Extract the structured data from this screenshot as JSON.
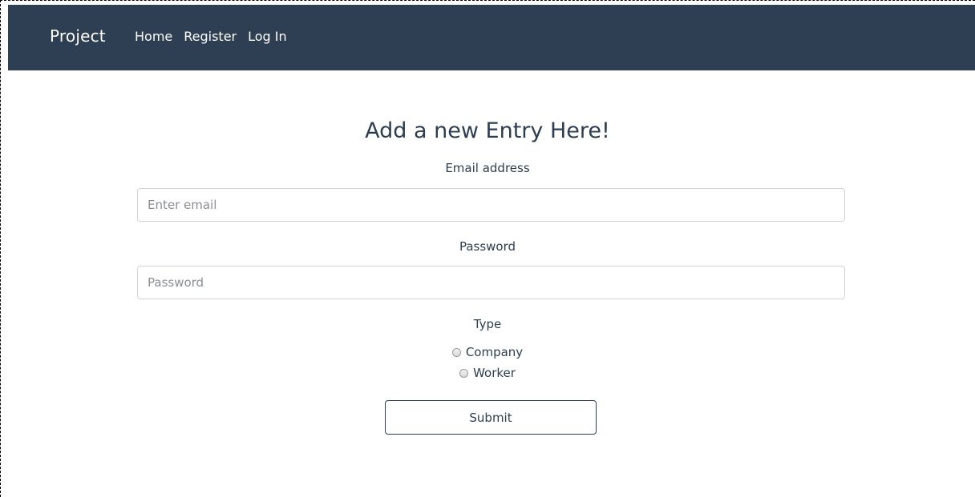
{
  "navbar": {
    "brand": "Project",
    "links": [
      "Home",
      "Register",
      "Log In"
    ],
    "background": "#2e3f53"
  },
  "form": {
    "heading": "Add a new Entry Here!",
    "email_label": "Email address",
    "email_placeholder": "Enter email",
    "email_value": "",
    "password_label": "Password",
    "password_placeholder": "Password",
    "password_value": "",
    "type_label": "Type",
    "type_options": [
      "Company",
      "Worker"
    ],
    "submit_label": "Submit"
  }
}
